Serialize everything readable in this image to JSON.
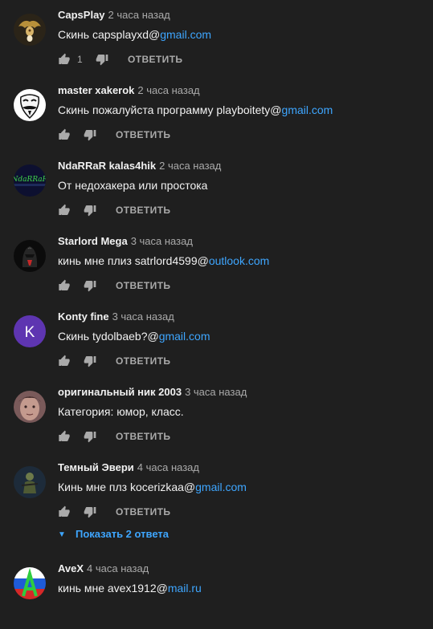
{
  "comments": [
    {
      "author": "CapsPlay",
      "time": "2 часа назад",
      "text_prefix": "Скинь capsplayxd@",
      "link": "gmail.com",
      "text_suffix": "",
      "likes": "1",
      "reply": "ОТВЕТИТЬ",
      "avatar": "ornate-medallion-icon"
    },
    {
      "author": "master xakerok",
      "time": "2 часа назад",
      "text_prefix": "Скинь пожалуйста программу playboitety@",
      "link": "gmail.com",
      "text_suffix": "",
      "likes": "",
      "reply": "ОТВЕТИТЬ",
      "avatar": "anonymous-mask-icon"
    },
    {
      "author": "NdaRRaR kalas4hik",
      "time": "2 часа назад",
      "text_prefix": "От недохакера или простока",
      "link": "",
      "text_suffix": "",
      "likes": "",
      "reply": "ОТВЕТИТЬ",
      "avatar": "ndarrar-logo",
      "avatar_text": "NdaRRaR"
    },
    {
      "author": "Starlord Mega",
      "time": "3 часа назад",
      "text_prefix": "кинь мне плиз satrlord4599@",
      "link": "outlook.com",
      "text_suffix": "",
      "likes": "",
      "reply": "ОТВЕТИТЬ",
      "avatar": "dark-helmet-icon"
    },
    {
      "author": "Konty fine",
      "time": "3 часа назад",
      "text_prefix": "Скинь tydolbaeb?@",
      "link": "gmail.com",
      "text_suffix": "",
      "likes": "",
      "reply": "ОТВЕТИТЬ",
      "avatar": "letter-avatar",
      "avatar_letter": "K"
    },
    {
      "author": "оригинальный ник 2003",
      "time": "3 часа назад",
      "text_prefix": "Категория: юмор, класс.",
      "link": "",
      "text_suffix": "",
      "likes": "",
      "reply": "ОТВЕТИТЬ",
      "avatar": "face-photo-icon"
    },
    {
      "author": "Темный Эвери",
      "time": "4 часа назад",
      "text_prefix": "Кинь мне плз kocerizkaa@",
      "link": "gmail.com",
      "text_suffix": "",
      "likes": "",
      "reply": "ОТВЕТИТЬ",
      "avatar": "soldier-figure-icon"
    },
    {
      "author": "AveX",
      "time": "4 часа назад",
      "text_prefix": "кинь мне avex1912@",
      "link": "mail.ru",
      "text_suffix": "",
      "likes": "",
      "reply": "",
      "avatar": "tricolor-letter-icon"
    }
  ],
  "show_replies": {
    "label": "Показать 2 ответа",
    "icon": "chevron-down-icon"
  },
  "colors": {
    "background": "#1f1f1f",
    "text": "#f1f1f1",
    "secondary": "#aaaaaa",
    "link": "#3ea6ff",
    "letter_avatar": "#5e35b1"
  }
}
